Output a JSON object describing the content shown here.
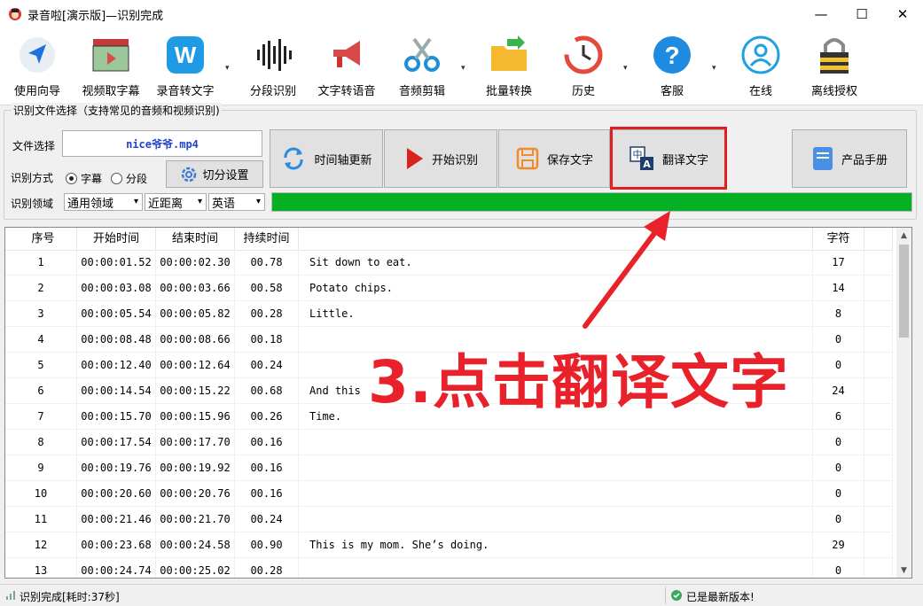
{
  "window": {
    "title": "录音啦[演示版]—识别完成",
    "minimize": "—",
    "maximize": "☐",
    "close": "✕"
  },
  "toolbar": [
    {
      "label": "使用向导",
      "icon": "navigation-arrow-icon"
    },
    {
      "label": "视频取字幕",
      "icon": "video-clapper-icon"
    },
    {
      "label": "录音转文字",
      "icon": "w-logo-icon"
    },
    {
      "label": "分段识别",
      "icon": "waveform-icon"
    },
    {
      "label": "文字转语音",
      "icon": "megaphone-icon"
    },
    {
      "label": "音频剪辑",
      "icon": "scissors-icon"
    },
    {
      "label": "批量转换",
      "icon": "folder-arrow-icon"
    },
    {
      "label": "历史",
      "icon": "history-clock-icon"
    },
    {
      "label": "客服",
      "icon": "question-icon"
    },
    {
      "label": "在线",
      "icon": "person-circle-icon"
    },
    {
      "label": "离线授权",
      "icon": "padlock-icon"
    }
  ],
  "dropdown_glyph": "▾",
  "file_group": {
    "title": "识别文件选择（支持常见的音频和视频识别)",
    "file_label": "文件选择",
    "file_name": "nice爷爷.mp4",
    "mode_label": "识别方式",
    "mode_options": [
      "字幕",
      "分段"
    ],
    "mode_selected": "字幕",
    "split_settings": "切分设置",
    "domain_label": "识别领域",
    "domain_value": "通用领域",
    "distance_value": "近距离",
    "language_value": "英语"
  },
  "actions": {
    "timeline_update": "时间轴更新",
    "start_recognize": "开始识别",
    "save_text": "保存文字",
    "translate_text": "翻译文字",
    "manual": "产品手册"
  },
  "progress": 1.0,
  "table": {
    "columns": [
      "序号",
      "开始时间",
      "结束时间",
      "持续时间",
      "",
      "字符"
    ],
    "rows": [
      [
        "1",
        "00:00:01.52",
        "00:00:02.30",
        "00.78",
        "Sit down to eat.",
        "17"
      ],
      [
        "2",
        "00:00:03.08",
        "00:00:03.66",
        "00.58",
        "Potato chips.",
        "14"
      ],
      [
        "3",
        "00:00:05.54",
        "00:00:05.82",
        "00.28",
        "Little.",
        "8"
      ],
      [
        "4",
        "00:00:08.48",
        "00:00:08.66",
        "00.18",
        "",
        "0"
      ],
      [
        "5",
        "00:00:12.40",
        "00:00:12.64",
        "00.24",
        "",
        "0"
      ],
      [
        "6",
        "00:00:14.54",
        "00:00:15.22",
        "00.68",
        "And this",
        "24"
      ],
      [
        "7",
        "00:00:15.70",
        "00:00:15.96",
        "00.26",
        "Time.",
        "6"
      ],
      [
        "8",
        "00:00:17.54",
        "00:00:17.70",
        "00.16",
        "",
        "0"
      ],
      [
        "9",
        "00:00:19.76",
        "00:00:19.92",
        "00.16",
        "",
        "0"
      ],
      [
        "10",
        "00:00:20.60",
        "00:00:20.76",
        "00.16",
        "",
        "0"
      ],
      [
        "11",
        "00:00:21.46",
        "00:00:21.70",
        "00.24",
        "",
        "0"
      ],
      [
        "12",
        "00:00:23.68",
        "00:00:24.58",
        "00.90",
        "This is my mom. She’s doing.",
        "29"
      ],
      [
        "13",
        "00:00:24.74",
        "00:00:25.02",
        "00.28",
        "",
        "0"
      ]
    ]
  },
  "annotation": "3.点击翻译文字",
  "status": {
    "left": "识别完成[耗时:37秒]",
    "right": "已是最新版本!"
  },
  "colors": {
    "highlight": "#e02020",
    "progress": "#06b025",
    "annotation": "#e8212a"
  }
}
